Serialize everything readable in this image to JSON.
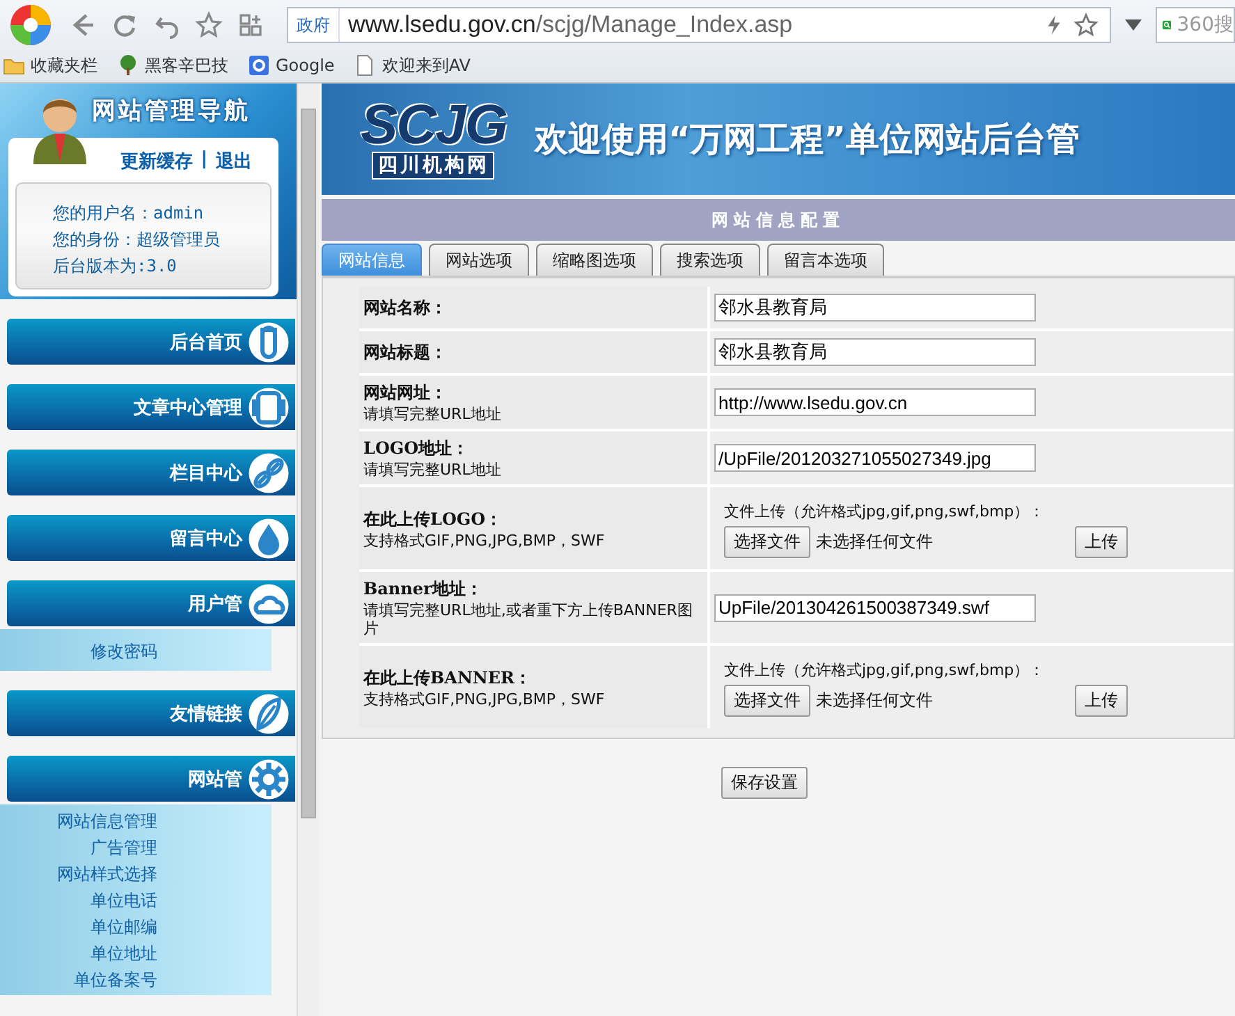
{
  "browser": {
    "address_tag": "政府",
    "url_host": "www.lsedu.gov.cn",
    "url_path": "/scjg/Manage_Index.asp",
    "search_placeholder": "360搜",
    "bookmarks": [
      {
        "label": "收藏夹栏",
        "kind": "folder"
      },
      {
        "label": "黑客辛巴技",
        "kind": "tree"
      },
      {
        "label": "Google",
        "kind": "google"
      },
      {
        "label": "欢迎来到AV",
        "kind": "page"
      }
    ]
  },
  "sidebar": {
    "title": "网站管理导航",
    "links": [
      "更新缓存",
      "退出"
    ],
    "separator": "|",
    "info": [
      "您的用户名：admin",
      "您的身份：超级管理员",
      "后台版本为:3.0"
    ],
    "menu": [
      {
        "label": "后台首页"
      },
      {
        "label": "文章中心管理"
      },
      {
        "label": "栏目中心"
      },
      {
        "label": "留言中心"
      },
      {
        "label": "用户管",
        "children": [
          "修改密码"
        ]
      },
      {
        "label": "友情链接"
      },
      {
        "label": "网站管",
        "children": [
          "网站信息管理",
          "广告管理",
          "网站样式选择",
          "单位电话",
          "单位邮编",
          "单位地址",
          "单位备案号"
        ]
      }
    ]
  },
  "banner": {
    "logo": "SCJG",
    "logo_subtitle": "四川机构网",
    "headline": "欢迎使用“万网工程”单位网站后台管"
  },
  "section_title": "网站信息配置",
  "tabs": [
    {
      "label": "网站信息",
      "selected": true
    },
    {
      "label": "网站选项",
      "selected": false
    },
    {
      "label": "缩略图选项",
      "selected": false
    },
    {
      "label": "搜索选项",
      "selected": false
    },
    {
      "label": "留言本选项",
      "selected": false
    }
  ],
  "form_rows": [
    {
      "kind": "text",
      "label": "网站名称：",
      "value": "邻水县教育局"
    },
    {
      "kind": "text",
      "label": "网站标题：",
      "value": "邻水县教育局"
    },
    {
      "kind": "text",
      "label": "网站网址：",
      "hint": "请填写完整URL地址",
      "value": "http://www.lsedu.gov.cn"
    },
    {
      "kind": "text",
      "label": "LOGO地址：",
      "hint": "请填写完整URL地址",
      "value": "/UpFile/201203271055027349.jpg"
    },
    {
      "kind": "upload",
      "label": "在此上传LOGO：",
      "hint": "支持格式GIF,PNG,JPG,BMP，SWF",
      "caption": "文件上传（允许格式jpg,gif,png,swf,bmp）：",
      "choose": "选择文件",
      "status": "未选择任何文件",
      "upload": "上传"
    },
    {
      "kind": "text",
      "label": "Banner地址：",
      "hint": "请填写完整URL地址,或者重下方上传BANNER图片",
      "value": "UpFile/201304261500387349.swf"
    },
    {
      "kind": "upload",
      "label": "在此上传BANNER：",
      "hint": "支持格式GIF,PNG,JPG,BMP，SWF",
      "caption": "文件上传（允许格式jpg,gif,png,swf,bmp）：",
      "choose": "选择文件",
      "status": "未选择任何文件",
      "upload": "上传"
    }
  ],
  "save_button": "保存设置"
}
